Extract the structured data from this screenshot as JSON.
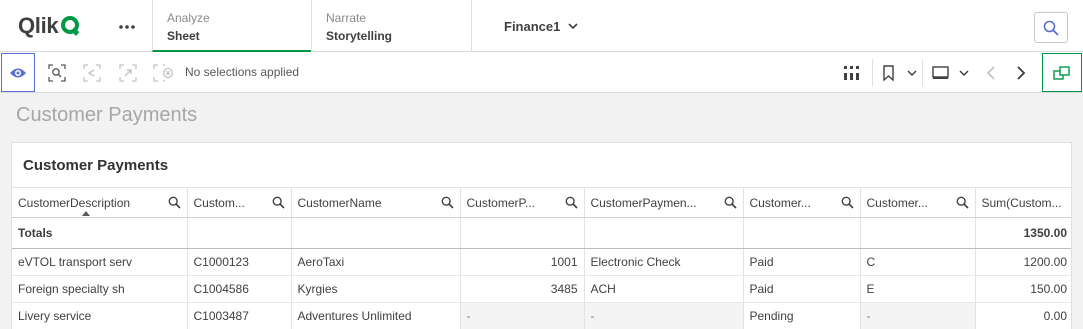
{
  "topbar": {
    "logo_text": "Qlik",
    "nav_tabs": [
      {
        "title": "Analyze",
        "value": "Sheet"
      },
      {
        "title": "Narrate",
        "value": "Storytelling"
      }
    ],
    "app_name": "Finance1"
  },
  "toolbar": {
    "selection_status": "No selections applied"
  },
  "sheet": {
    "title": "Customer Payments"
  },
  "table": {
    "title": "Customer Payments",
    "columns": [
      "CustomerDescription",
      "Custom...",
      "CustomerName",
      "CustomerP...",
      "CustomerPaymen...",
      "Customer...",
      "Customer...",
      "Sum(Custom..."
    ],
    "totals": [
      "Totals",
      "",
      "",
      "",
      "",
      "",
      "",
      "1350.00"
    ],
    "rows": [
      [
        "eVTOL transport serv",
        "C1000123",
        "AeroTaxi",
        "1001",
        "Electronic Check",
        "Paid",
        "C",
        "1200.00"
      ],
      [
        "Foreign specialty sh",
        "C1004586",
        "Kyrgies",
        "3485",
        "ACH",
        "Paid",
        "E",
        "150.00"
      ],
      [
        "Livery service",
        "C1003487",
        "Adventures Unlimited",
        "-",
        "-",
        "Pending",
        "-",
        "0.00"
      ]
    ]
  }
}
